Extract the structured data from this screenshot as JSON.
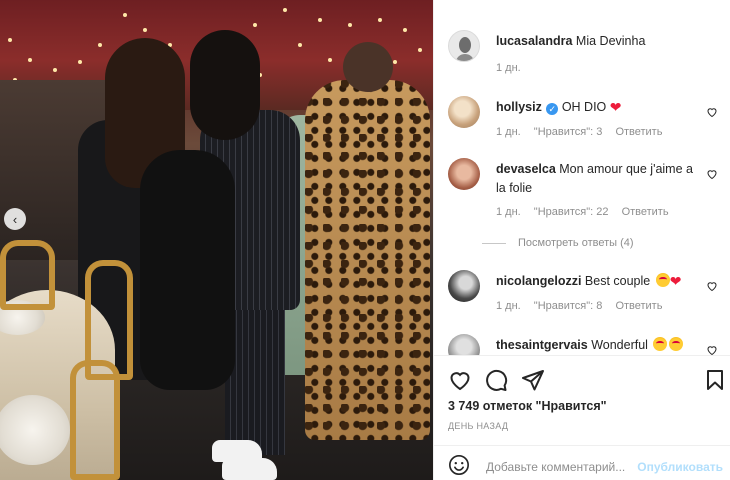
{
  "post": {
    "carousel_nav_icon": "chevron-left-icon"
  },
  "caption": {
    "username": "lucasalandra",
    "text": "Mia Devinha",
    "time": "1 дн."
  },
  "comments": [
    {
      "username": "hollysiz",
      "verified": true,
      "text": "OH DIO",
      "emoji": [
        "red-heart"
      ],
      "time": "1 дн.",
      "likes": "\"Нравится\": 3",
      "reply": "Ответить"
    },
    {
      "username": "devaselca",
      "verified": false,
      "text": "Mon amour que j'aime a la folie",
      "emoji": [],
      "time": "1 дн.",
      "likes": "\"Нравится\": 22",
      "reply": "Ответить"
    },
    {
      "username": "nicolangelozzi",
      "verified": false,
      "text": "Best couple",
      "emoji": [
        "heart-eyes-face",
        "red-heart"
      ],
      "time": "1 дн.",
      "likes": "\"Нравится\": 8",
      "reply": "Ответить"
    },
    {
      "username": "thesaintgervais",
      "verified": false,
      "text": "Wonderful",
      "emoji": [
        "heart-eyes-face",
        "heart-eyes-face"
      ],
      "time": "",
      "likes": "",
      "reply": ""
    }
  ],
  "view_replies": "Посмотреть ответы (4)",
  "actions": {
    "like_icon": "heart-outline-icon",
    "comment_icon": "comment-bubble-icon",
    "share_icon": "paper-plane-icon",
    "save_icon": "bookmark-icon"
  },
  "likes_text": "3 749 отметок \"Нравится\"",
  "date_text": "ДЕНЬ НАЗАД",
  "add_comment": {
    "placeholder": "Добавьте комментарий...",
    "publish_label": "Опубликовать",
    "emoji_icon": "smiley-face-icon"
  },
  "colors": {
    "accent": "#0095f6",
    "publish_disabled": "#b2dffc",
    "heart": "#ed4956",
    "verified": "#3897f0"
  }
}
